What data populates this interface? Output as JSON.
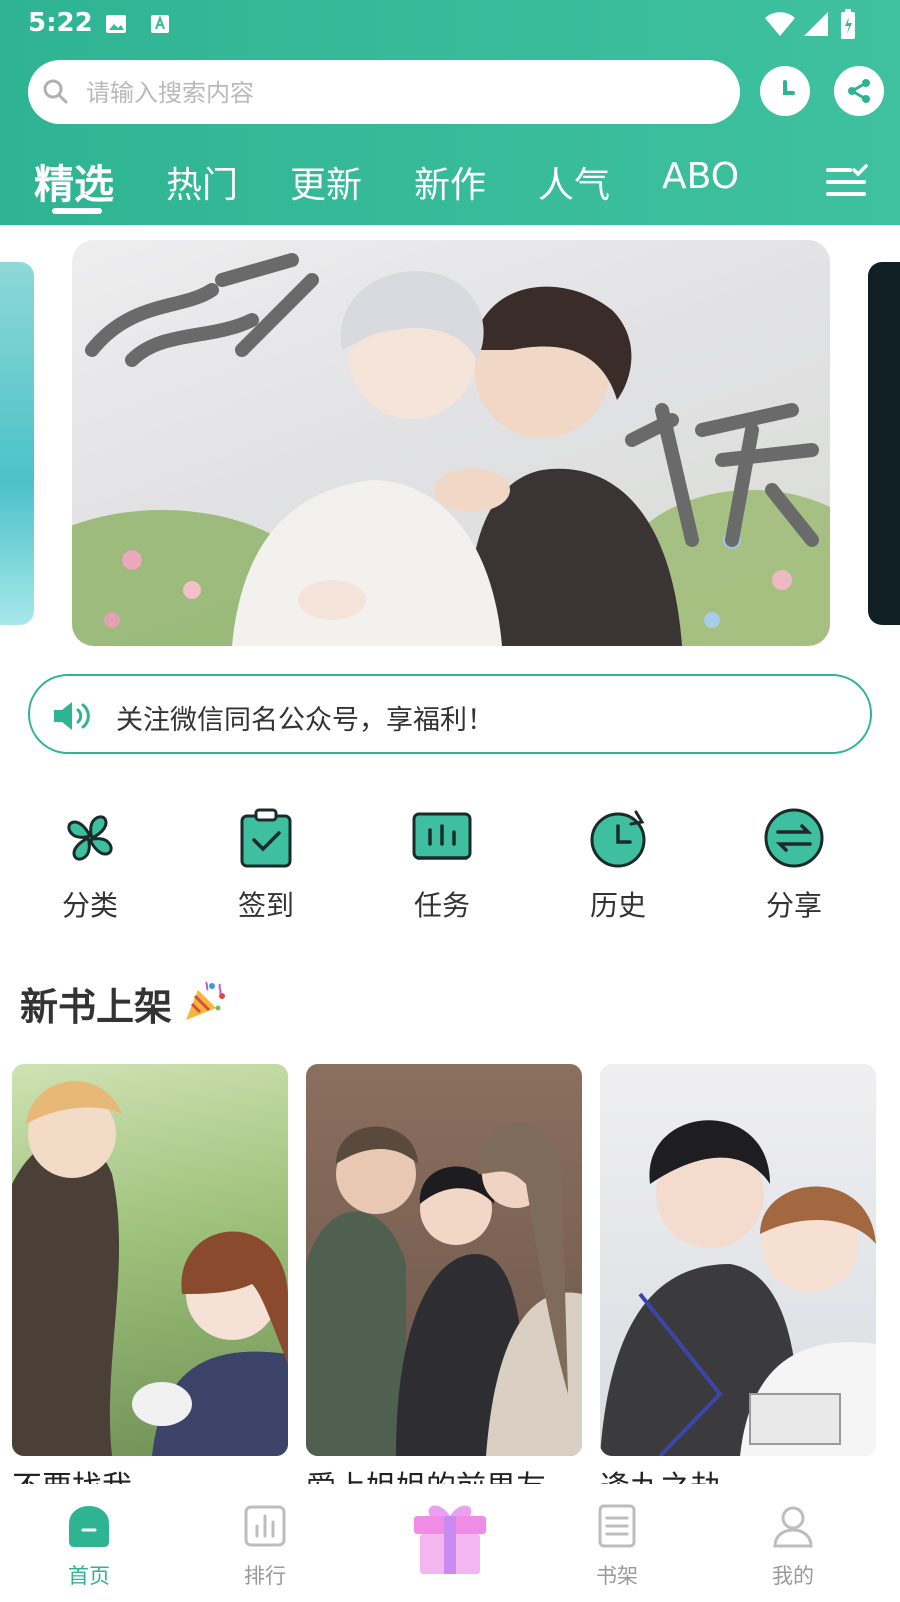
{
  "status": {
    "time": "5:22"
  },
  "search": {
    "placeholder": "请输入搜索内容"
  },
  "tabs": [
    {
      "label": "精选",
      "active": true
    },
    {
      "label": "热门"
    },
    {
      "label": "更新"
    },
    {
      "label": "新作"
    },
    {
      "label": "人气"
    },
    {
      "label": "ABO"
    }
  ],
  "banner": {
    "title_left": "心跡",
    "title_right": "斩癮"
  },
  "notice": {
    "text": "关注微信同名公众号，享福利！"
  },
  "quick_actions": [
    {
      "label": "分类",
      "icon": "clover-icon"
    },
    {
      "label": "签到",
      "icon": "checkin-icon"
    },
    {
      "label": "任务",
      "icon": "task-icon"
    },
    {
      "label": "历史",
      "icon": "history-icon"
    },
    {
      "label": "分享",
      "icon": "share-icon"
    }
  ],
  "section": {
    "title": "新书上架"
  },
  "books": [
    {
      "title": "不要找我"
    },
    {
      "title": "爱上姐姐的前男友"
    },
    {
      "title": "逢九之劫"
    }
  ],
  "bottom_nav": [
    {
      "label": "首页",
      "active": true
    },
    {
      "label": "排行"
    },
    {
      "label": "书架"
    },
    {
      "label": "我的"
    }
  ],
  "colors": {
    "accent": "#2fb493",
    "inactive": "#9a9a9a"
  }
}
